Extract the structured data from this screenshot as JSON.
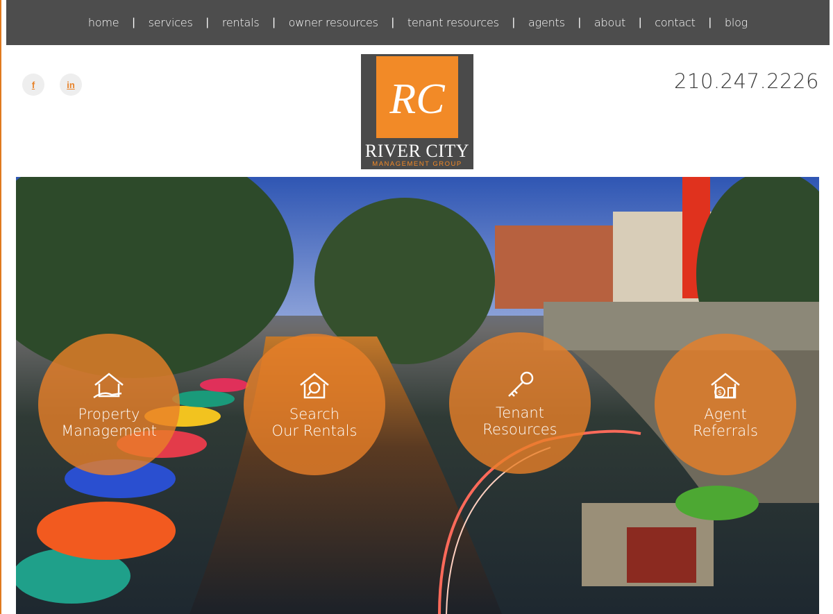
{
  "nav": {
    "items": [
      {
        "label": "home"
      },
      {
        "label": "services"
      },
      {
        "label": "rentals"
      },
      {
        "label": "owner resources"
      },
      {
        "label": "tenant resources"
      },
      {
        "label": "agents"
      },
      {
        "label": "about"
      },
      {
        "label": "contact"
      },
      {
        "label": "blog"
      }
    ],
    "separator": "|"
  },
  "social": {
    "facebook_glyph": "f",
    "linkedin_glyph": "in",
    "facebook_icon": "facebook-icon",
    "linkedin_icon": "linkedin-icon"
  },
  "header": {
    "phone": "210.247.2226"
  },
  "logo": {
    "monogram": "RC",
    "name": "RIVER CITY",
    "subtitle": "MANAGEMENT GROUP"
  },
  "features": [
    {
      "label": "Property\nManagement",
      "icon": "house-hand-icon"
    },
    {
      "label": "Search\nOur Rentals",
      "icon": "house-search-icon"
    },
    {
      "label": "Tenant\nResources",
      "icon": "keys-icon"
    },
    {
      "label": "Agent\nReferrals",
      "icon": "house-dollar-icon"
    }
  ],
  "colors": {
    "accent": "#e8832a",
    "nav_bg": "#4d4d4d",
    "logo_bg": "#4a4a4a"
  }
}
